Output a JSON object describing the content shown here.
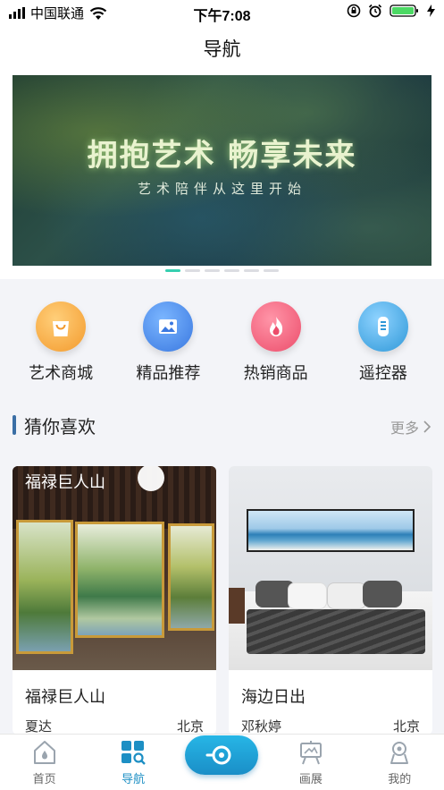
{
  "status_bar": {
    "carrier": "中国联通",
    "time": "下午7:08"
  },
  "nav": {
    "title": "导航"
  },
  "banner": {
    "title": "拥抱艺术 畅享未来",
    "subtitle": "艺术陪伴从这里开始",
    "slide_count": 6,
    "active_slide": 1
  },
  "categories": [
    {
      "label": "艺术商城",
      "icon": "shopping-bag-icon",
      "color": "#f5a23c"
    },
    {
      "label": "精品推荐",
      "icon": "picture-icon",
      "color": "#4a8fe8"
    },
    {
      "label": "热销商品",
      "icon": "flame-icon",
      "color": "#f0607a"
    },
    {
      "label": "遥控器",
      "icon": "remote-control-icon",
      "color": "#3fa6e0"
    }
  ],
  "section": {
    "title": "猜你喜欢",
    "more": "更多"
  },
  "products": [
    {
      "title": "福禄巨人山",
      "image_caption": "福禄巨人山",
      "author": "夏达",
      "city": "北京"
    },
    {
      "title": "海边日出",
      "author": "邓秋婷",
      "city": "北京"
    }
  ],
  "tabs": [
    {
      "label": "首页",
      "icon": "home-icon"
    },
    {
      "label": "导航",
      "icon": "grid-search-icon",
      "active": true
    },
    {
      "label": "",
      "icon": "remote-eye-icon",
      "center": true
    },
    {
      "label": "画展",
      "icon": "easel-icon"
    },
    {
      "label": "我的",
      "icon": "user-badge-icon"
    }
  ],
  "colors": {
    "accent": "#1d8fc4",
    "active_dot": "#36cfb0",
    "section_bar": "#3a6ea5"
  }
}
